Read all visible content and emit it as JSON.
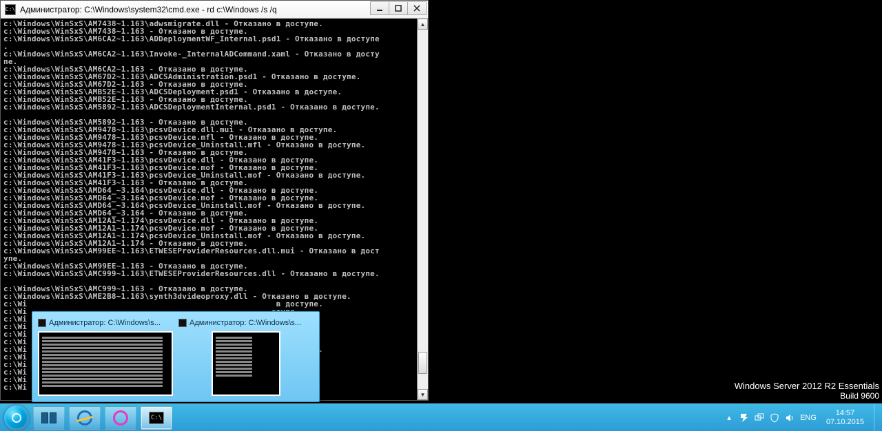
{
  "window": {
    "title": "Администратор: C:\\Windows\\system32\\cmd.exe - rd  c:\\Windows /s /q",
    "sys_icon_glyph": "C:\\"
  },
  "console_lines": [
    "c:\\Windows\\WinSxS\\AM7438~1.163\\adwsmigrate.dll - Отказано в доступе.",
    "c:\\Windows\\WinSxS\\AM7438~1.163 - Отказано в доступе.",
    "c:\\Windows\\WinSxS\\AM6CA2~1.163\\ADDeploymentWF_Internal.psd1 - Отказано в доступе",
    ".",
    "c:\\Windows\\WinSxS\\AM6CA2~1.163\\Invoke-_InternalADCommand.xaml - Отказано в досту",
    "пе.",
    "c:\\Windows\\WinSxS\\AM6CA2~1.163 - Отказано в доступе.",
    "c:\\Windows\\WinSxS\\AM67D2~1.163\\ADCSAdministration.psd1 - Отказано в доступе.",
    "c:\\Windows\\WinSxS\\AM67D2~1.163 - Отказано в доступе.",
    "c:\\Windows\\WinSxS\\AMB52E~1.163\\ADCSDeployment.psd1 - Отказано в доступе.",
    "c:\\Windows\\WinSxS\\AMB52E~1.163 - Отказано в доступе.",
    "c:\\Windows\\WinSxS\\AM5892~1.163\\ADCSDeploymentInternal.psd1 - Отказано в доступе.",
    "",
    "c:\\Windows\\WinSxS\\AM5892~1.163 - Отказано в доступе.",
    "c:\\Windows\\WinSxS\\AM9478~1.163\\pcsvDevice.dll.mui - Отказано в доступе.",
    "c:\\Windows\\WinSxS\\AM9478~1.163\\pcsvDevice.mfl - Отказано в доступе.",
    "c:\\Windows\\WinSxS\\AM9478~1.163\\pcsvDevice_Uninstall.mfl - Отказано в доступе.",
    "c:\\Windows\\WinSxS\\AM9478~1.163 - Отказано в доступе.",
    "c:\\Windows\\WinSxS\\AM41F3~1.163\\pcsvDevice.dll - Отказано в доступе.",
    "c:\\Windows\\WinSxS\\AM41F3~1.163\\pcsvDevice.mof - Отказано в доступе.",
    "c:\\Windows\\WinSxS\\AM41F3~1.163\\pcsvDevice_Uninstall.mof - Отказано в доступе.",
    "c:\\Windows\\WinSxS\\AM41F3~1.163 - Отказано в доступе.",
    "c:\\Windows\\WinSxS\\AMD64_~3.164\\pcsvDevice.dll - Отказано в доступе.",
    "c:\\Windows\\WinSxS\\AMD64_~3.164\\pcsvDevice.mof - Отказано в доступе.",
    "c:\\Windows\\WinSxS\\AMD64_~3.164\\pcsvDevice_Uninstall.mof - Отказано в доступе.",
    "c:\\Windows\\WinSxS\\AMD64_~3.164 - Отказано в доступе.",
    "c:\\Windows\\WinSxS\\AM12A1~1.174\\pcsvDevice.dll - Отказано в доступе.",
    "c:\\Windows\\WinSxS\\AM12A1~1.174\\pcsvDevice.mof - Отказано в доступе.",
    "c:\\Windows\\WinSxS\\AM12A1~1.174\\pcsvDevice_Uninstall.mof - Отказано в доступе.",
    "c:\\Windows\\WinSxS\\AM12A1~1.174 - Отказано в доступе.",
    "c:\\Windows\\WinSxS\\AM99EE~1.163\\ETWESEProviderResources.dll.mui - Отказано в дост",
    "упе.",
    "c:\\Windows\\WinSxS\\AM99EE~1.163 - Отказано в доступе.",
    "c:\\Windows\\WinSxS\\AMC999~1.163\\ETWESEProviderResources.dll - Отказано в доступе.",
    "",
    "c:\\Windows\\WinSxS\\AMC999~1.163 - Отказано в доступе.",
    "c:\\Windows\\WinSxS\\AME2B8~1.163\\synth3dvideoproxy.dll - Отказано в доступе.",
    "c:\\Wi                                                     в доступе.",
    "c:\\Wi                                                    ступе.",
    "c:\\Wi                                                   ступе.",
    "c:\\Wi                                                     оступе.",
    "c:\\Wi                                                     оступе.",
    "c:\\Wi                                                     оступе.",
    "c:\\Wi                                                       доступе.",
    "c:\\Wi                                                   ступе.",
    "c:\\Wi                                                     доступе.",
    "c:\\Wi                                                   ступе.",
    "c:\\Wi                                                    доступе.",
    "c:\\Wi                                                   ступе."
  ],
  "previews": [
    {
      "title": "Администратор: C:\\Windows\\s..."
    },
    {
      "title": "Администратор: C:\\Windows\\s..."
    }
  ],
  "watermark": {
    "line1": "Windows Server 2012 R2 Essentials",
    "line2": "Build 9600"
  },
  "tray": {
    "lang": "ENG",
    "time": "14:57",
    "date": "07.10.2015"
  }
}
